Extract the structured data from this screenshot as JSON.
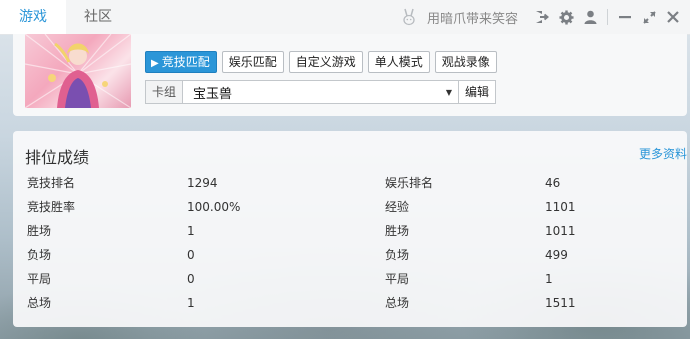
{
  "tabs": [
    {
      "label": "游戏"
    },
    {
      "label": "社区"
    }
  ],
  "user": {
    "name": "用暗爪带来笑容"
  },
  "icons": {
    "avatar": "bunny-avatar-icon",
    "logout": "logout-icon",
    "settings": "gear-icon",
    "user": "user-icon",
    "minimize": "minimize-icon",
    "maximize": "expand-icon",
    "close": "close-icon"
  },
  "modes": [
    {
      "label": "竞技匹配"
    },
    {
      "label": "娱乐匹配"
    },
    {
      "label": "自定义游戏"
    },
    {
      "label": "单人模式"
    },
    {
      "label": "观战录像"
    }
  ],
  "deck": {
    "label": "卡组",
    "value": "宝玉兽",
    "edit_label": "编辑"
  },
  "rank": {
    "title": "排位成绩",
    "more_label": "更多资料",
    "rows": [
      {
        "k1": "竞技排名",
        "v1": "1294",
        "k2": "娱乐排名",
        "v2": "46"
      },
      {
        "k1": "竞技胜率",
        "v1": "100.00%",
        "k2": "经验",
        "v2": "1101"
      },
      {
        "k1": "胜场",
        "v1": "1",
        "k2": "胜场",
        "v2": "1011"
      },
      {
        "k1": "负场",
        "v1": "0",
        "k2": "负场",
        "v2": "499"
      },
      {
        "k1": "平局",
        "v1": "0",
        "k2": "平局",
        "v2": "1"
      },
      {
        "k1": "总场",
        "v1": "1",
        "k2": "总场",
        "v2": "1511"
      }
    ]
  },
  "colors": {
    "accent": "#2b96d8"
  }
}
